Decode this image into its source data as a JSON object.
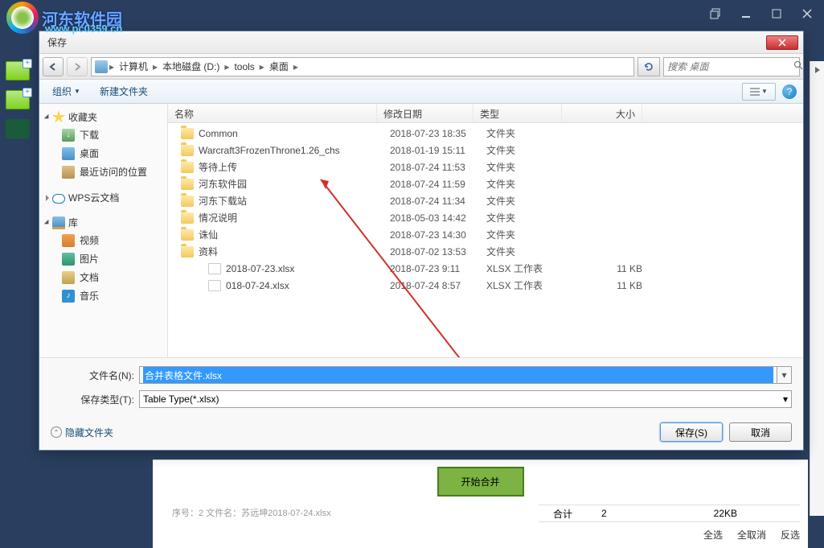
{
  "watermark": {
    "text": "河东软件园",
    "sub": "www.pc0359.cn"
  },
  "dialog": {
    "title": "保存",
    "breadcrumb": [
      "计算机",
      "本地磁盘 (D:)",
      "tools",
      "桌面"
    ],
    "search_placeholder": "搜索 桌面",
    "toolbar": {
      "organize": "组织",
      "new_folder": "新建文件夹"
    },
    "help": "?",
    "sidebar": {
      "fav": {
        "head": "收藏夹",
        "items": [
          "下载",
          "桌面",
          "最近访问的位置"
        ]
      },
      "cloud": {
        "head": "WPS云文档"
      },
      "lib": {
        "head": "库",
        "items": [
          "视频",
          "图片",
          "文档",
          "音乐"
        ]
      }
    },
    "columns": {
      "name": "名称",
      "date": "修改日期",
      "type": "类型",
      "size": "大小"
    },
    "files": [
      {
        "name": "Common",
        "date": "2018-07-23 18:35",
        "type": "文件夹",
        "size": "",
        "kind": "folder"
      },
      {
        "name": "Warcraft3FrozenThrone1.26_chs",
        "date": "2018-01-19 15:11",
        "type": "文件夹",
        "size": "",
        "kind": "folder"
      },
      {
        "name": "等待上传",
        "date": "2018-07-24 11:53",
        "type": "文件夹",
        "size": "",
        "kind": "folder"
      },
      {
        "name": "河东软件园",
        "date": "2018-07-24 11:59",
        "type": "文件夹",
        "size": "",
        "kind": "folder"
      },
      {
        "name": "河东下载站",
        "date": "2018-07-24 11:34",
        "type": "文件夹",
        "size": "",
        "kind": "folder"
      },
      {
        "name": "情况说明",
        "date": "2018-05-03 14:42",
        "type": "文件夹",
        "size": "",
        "kind": "folder"
      },
      {
        "name": "诛仙",
        "date": "2018-07-23 14:30",
        "type": "文件夹",
        "size": "",
        "kind": "folder"
      },
      {
        "name": "资料",
        "date": "2018-07-02 13:53",
        "type": "文件夹",
        "size": "",
        "kind": "folder"
      },
      {
        "name": "2018-07-23.xlsx",
        "date": "2018-07-23 9:11",
        "type": "XLSX 工作表",
        "size": "11 KB",
        "kind": "file"
      },
      {
        "name": "018-07-24.xlsx",
        "date": "2018-07-24 8:57",
        "type": "XLSX 工作表",
        "size": "11 KB",
        "kind": "file"
      }
    ],
    "filename_label": "文件名(N):",
    "filename_value": "合并表格文件.xlsx",
    "savetype_label": "保存类型(T):",
    "savetype_value": "Table Type(*.xlsx)",
    "hide_folders": "隐藏文件夹",
    "save_btn": "保存(S)",
    "cancel_btn": "取消"
  },
  "bottom": {
    "start_merge": "开始合并",
    "info": "序号：2 文件名：苏远坤2018-07-24.xlsx",
    "total_label": "合计",
    "total_count": "2",
    "total_size": "22KB",
    "select_all": "全选",
    "deselect_all": "全取消",
    "invert": "反选"
  }
}
